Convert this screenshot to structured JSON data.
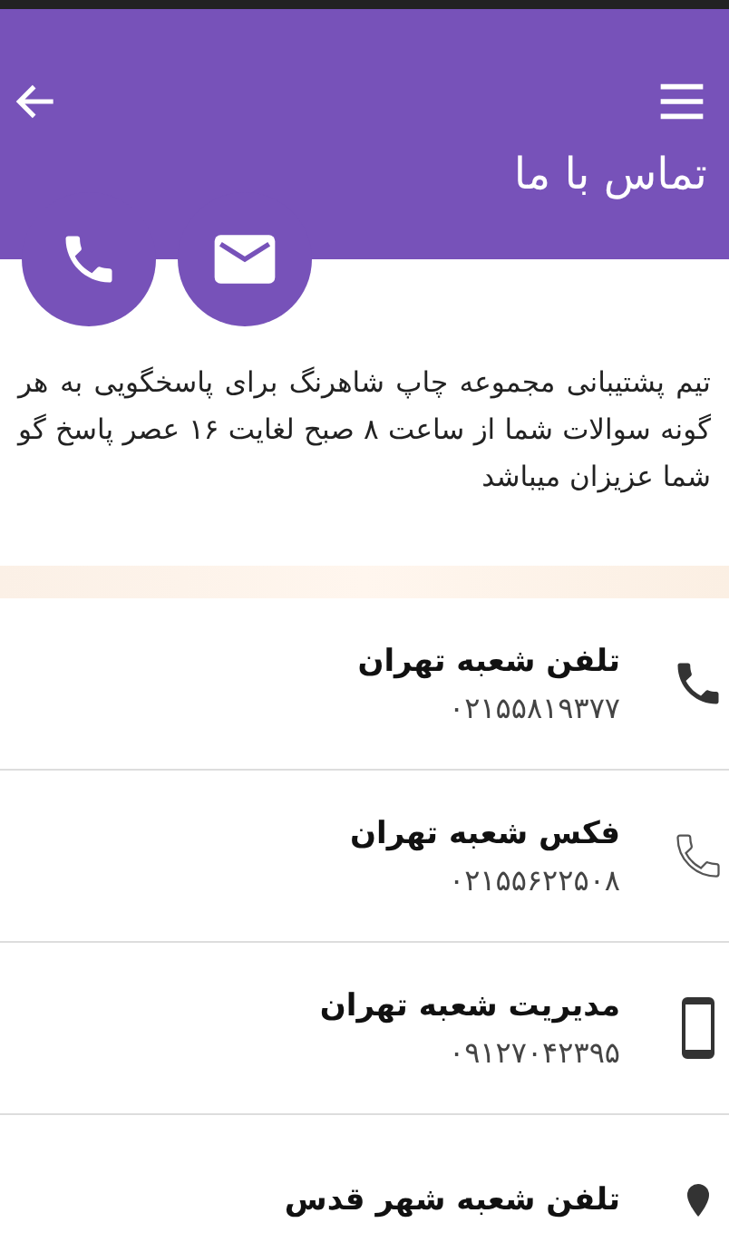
{
  "header": {
    "title": "تماس با ما"
  },
  "intro": "تیم پشتیبانی مجموعه چاپ شاهرنگ برای پاسخگویی به هر گونه سوالات شما از ساعت ۸ صبح لغایت ۱۶ عصر پاسخ گو شما عزیزان میباشد",
  "contacts": [
    {
      "kind": "phone",
      "title": "تلفن شعبه تهران",
      "number": "۰۲۱۵۵۸۱۹۳۷۷"
    },
    {
      "kind": "fax",
      "title": "فکس شعبه تهران",
      "number": "۰۲۱۵۵۶۲۲۵۰۸"
    },
    {
      "kind": "mobile",
      "title": "مدیریت شعبه تهران",
      "number": "۰۹۱۲۷۰۴۲۳۹۵"
    },
    {
      "kind": "location",
      "title": "تلفن شعبه شهر قدس"
    }
  ]
}
